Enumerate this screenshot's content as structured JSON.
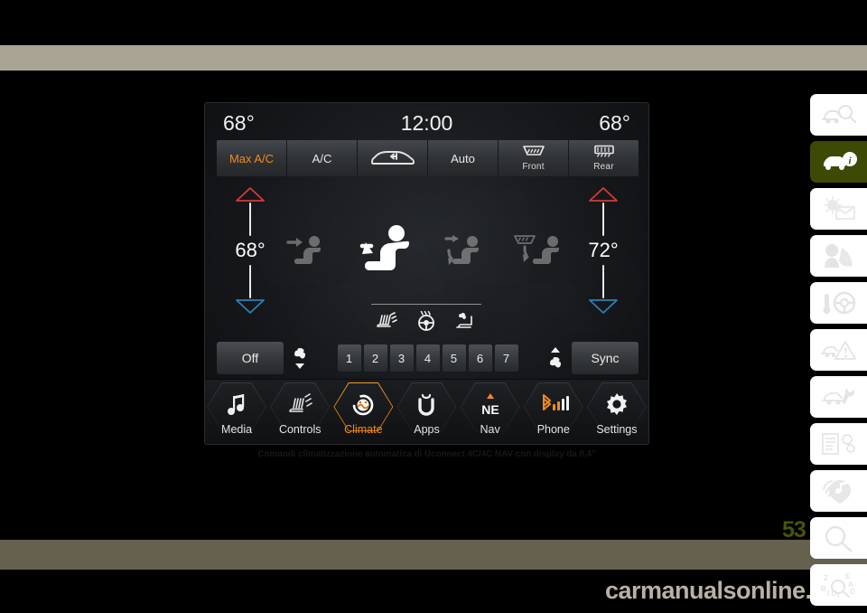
{
  "page": {
    "number": "53",
    "watermark": "carmanualsonline.info",
    "caption": "Comandi climatizzazione automatica di Uconnect 4C/4C NAV con display da 8,4\""
  },
  "screen": {
    "header": {
      "left_temp": "68°",
      "clock": "12:00",
      "right_temp": "68°"
    },
    "top_buttons": [
      {
        "label": "Max A/C",
        "icon": "",
        "sub": "",
        "active": true
      },
      {
        "label": "A/C",
        "icon": "",
        "sub": "",
        "active": false
      },
      {
        "label": "",
        "icon": "recirculation-car-icon",
        "sub": "",
        "active": false
      },
      {
        "label": "Auto",
        "icon": "",
        "sub": "",
        "active": false
      },
      {
        "label": "",
        "icon": "front-defrost-icon",
        "sub": "Front",
        "active": false
      },
      {
        "label": "",
        "icon": "rear-defrost-icon",
        "sub": "Rear",
        "active": false
      }
    ],
    "left_zone": {
      "up_icon": "triangle-up-icon",
      "temp": "68°",
      "down_icon": "triangle-down-icon"
    },
    "right_zone": {
      "up_icon": "triangle-up-icon",
      "temp": "72°",
      "down_icon": "triangle-down-icon"
    },
    "airflow_modes": [
      {
        "name": "mode-face-icon",
        "selected": false
      },
      {
        "name": "mode-face-and-feet-icon",
        "selected": true
      },
      {
        "name": "mode-feet-icon",
        "selected": false
      },
      {
        "name": "mode-defrost-and-feet-icon",
        "selected": false
      }
    ],
    "comfort_icons": [
      {
        "name": "heated-seat-icon"
      },
      {
        "name": "heated-steering-wheel-icon"
      },
      {
        "name": "ventilated-seat-icon"
      }
    ],
    "fan_row": {
      "off_label": "Off",
      "fan_down_icon": "fan-decrease-icon",
      "steps": [
        "1",
        "2",
        "3",
        "4",
        "5",
        "6",
        "7"
      ],
      "fan_up_icon": "fan-increase-icon",
      "sync_label": "Sync"
    },
    "nav": [
      {
        "label": "Media",
        "icon": "music-note-icon",
        "active": false
      },
      {
        "label": "Controls",
        "icon": "heated-seat-controls-icon",
        "active": false
      },
      {
        "label": "Climate",
        "icon": "climate-fan-icon",
        "active": true
      },
      {
        "label": "Apps",
        "icon": "uconnect-u-icon",
        "active": false
      },
      {
        "label": "Nav",
        "icon": "compass-ne-icon",
        "icon_text": "NE",
        "active": false
      },
      {
        "label": "Phone",
        "icon": "bluetooth-signal-icon",
        "active": false
      },
      {
        "label": "Settings",
        "icon": "gear-icon",
        "active": false
      }
    ]
  },
  "tab_rail": [
    {
      "name": "tab-vehicle-search",
      "active": false
    },
    {
      "name": "tab-vehicle-info",
      "active": true
    },
    {
      "name": "tab-multimedia-mail",
      "active": false
    },
    {
      "name": "tab-safety-airbag",
      "active": false
    },
    {
      "name": "tab-starting-driving",
      "active": false
    },
    {
      "name": "tab-emergency",
      "active": false
    },
    {
      "name": "tab-service-maintenance",
      "active": false
    },
    {
      "name": "tab-specifications",
      "active": false
    },
    {
      "name": "tab-multimedia",
      "active": false
    },
    {
      "name": "tab-search",
      "active": false
    },
    {
      "name": "tab-index",
      "active": false
    }
  ],
  "colors": {
    "accent_orange": "#f08a1e",
    "band_top": "#aaa494",
    "band_bottom": "#66604f",
    "tab_active": "#3d4a06",
    "page_number": "#4a5406"
  }
}
